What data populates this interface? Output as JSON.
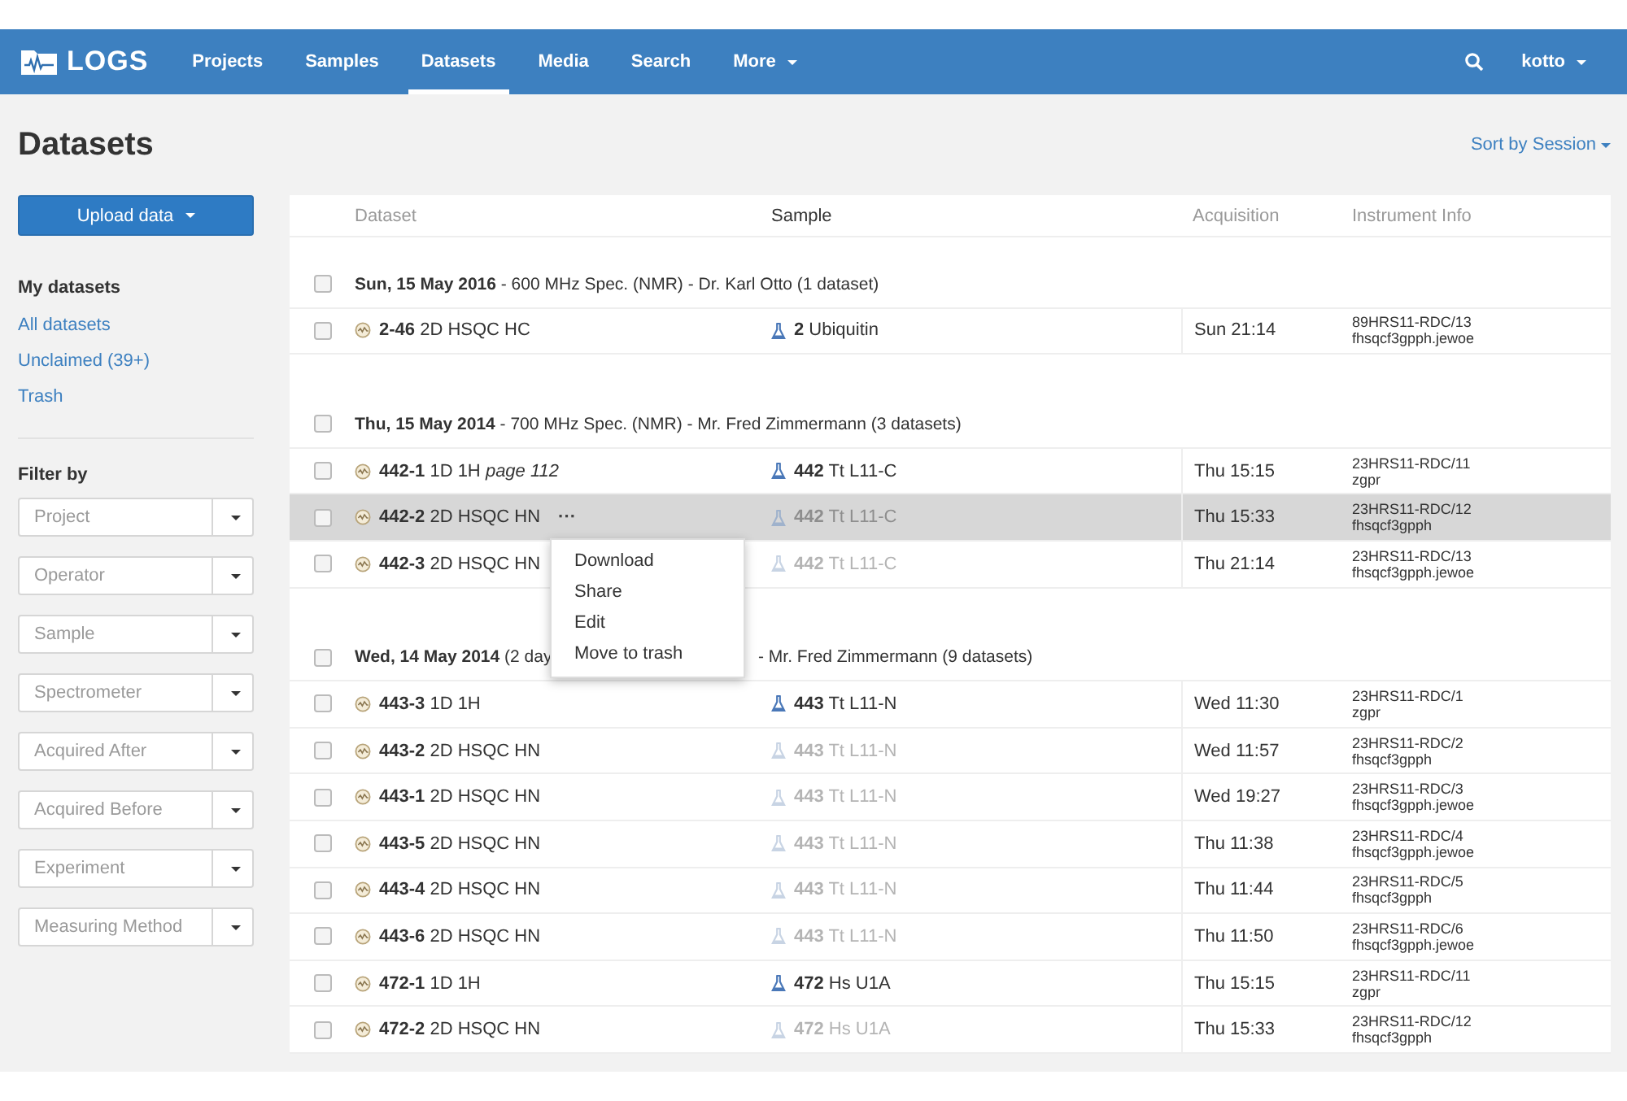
{
  "navbar": {
    "logo": "LOGS",
    "items": [
      {
        "label": "Projects",
        "selected": false
      },
      {
        "label": "Samples",
        "selected": false
      },
      {
        "label": "Datasets",
        "selected": true
      },
      {
        "label": "Media",
        "selected": false
      },
      {
        "label": "Search",
        "selected": false
      },
      {
        "label": "More",
        "selected": false,
        "dropdown": true
      }
    ],
    "user": "kotto"
  },
  "page_title": "Datasets",
  "sort": "Sort by Session",
  "sidebar": {
    "upload_button": "Upload data",
    "section_title": "My datasets",
    "links": [
      "All datasets",
      "Unclaimed (39+)",
      "Trash"
    ],
    "filter_title": "Filter by",
    "filters": [
      {
        "placeholder": "Project"
      },
      {
        "placeholder": "Operator"
      },
      {
        "placeholder": "Sample"
      },
      {
        "placeholder": "Spectrometer"
      },
      {
        "placeholder": "Acquired After"
      },
      {
        "placeholder": "Acquired Before"
      },
      {
        "placeholder": "Experiment"
      },
      {
        "placeholder": "Measuring Method"
      }
    ]
  },
  "table": {
    "columns": [
      "Dataset",
      "Sample",
      "Acquisition",
      "Instrument Info"
    ],
    "groups": [
      {
        "checked": false,
        "date": "Sun, 15 May 2016",
        "info": "- 600 MHz Spec. (NMR) - Dr. Karl Otto (1 dataset)",
        "rows": [
          {
            "checked": false,
            "selected": false,
            "id": "2-46",
            "name": "2D HSQC HC",
            "sample_no": "2",
            "sample": "Ubiquitin",
            "sample_active": true,
            "acquisition": "Sun 21:14",
            "instrument": [
              "89HRS11-RDC/13",
              "fhsqcf3gpph.jewoe"
            ]
          }
        ]
      },
      {
        "checked": false,
        "date": "Thu, 15 May 2014",
        "info": "- 700 MHz Spec. (NMR) - Mr. Fred Zimmermann (3 datasets)",
        "rows": [
          {
            "checked": false,
            "selected": false,
            "id": "442-1",
            "name": "1D 1H",
            "note": "page 112",
            "sample_no": "442",
            "sample": "Tt L11-C",
            "sample_active": true,
            "acquisition": "Thu 15:15",
            "instrument": [
              "23HRS11-RDC/11",
              "zgpr"
            ]
          },
          {
            "checked": false,
            "selected": true,
            "id": "442-2",
            "name": "2D HSQC HN",
            "more": "···",
            "sample_no": "442",
            "sample": "Tt L11-C",
            "sample_active": false,
            "acquisition": "Thu 15:33",
            "instrument": [
              "23HRS11-RDC/12",
              "fhsqcf3gpph"
            ],
            "menu": [
              "Download",
              "Share",
              "Edit",
              "Move to trash"
            ]
          },
          {
            "checked": false,
            "selected": false,
            "id": "442-3",
            "name": "2D HSQC HN",
            "sample_no": "442",
            "sample": "Tt L11-C",
            "sample_active": false,
            "acquisition": "Thu 21:14",
            "instrument": [
              "23HRS11-RDC/13",
              "fhsqcf3gpph.jewoe"
            ]
          }
        ]
      },
      {
        "checked": false,
        "date": "Wed, 14 May 2014",
        "info": "(2 day",
        "info_after_menu": "- Mr. Fred Zimmermann (9 datasets)",
        "rows": [
          {
            "checked": false,
            "selected": false,
            "id": "443-3",
            "name": "1D 1H",
            "sample_no": "443",
            "sample": "Tt L11-N",
            "sample_active": true,
            "acquisition": "Wed 11:30",
            "instrument": [
              "23HRS11-RDC/1",
              "zgpr"
            ]
          },
          {
            "checked": false,
            "selected": false,
            "id": "443-2",
            "name": "2D HSQC HN",
            "sample_no": "443",
            "sample": "Tt L11-N",
            "sample_active": false,
            "acquisition": "Wed 11:57",
            "instrument": [
              "23HRS11-RDC/2",
              "fhsqcf3gpph"
            ]
          },
          {
            "checked": false,
            "selected": false,
            "id": "443-1",
            "name": "2D HSQC HN",
            "sample_no": "443",
            "sample": "Tt L11-N",
            "sample_active": false,
            "acquisition": "Wed 19:27",
            "instrument": [
              "23HRS11-RDC/3",
              "fhsqcf3gpph.jewoe"
            ]
          },
          {
            "checked": false,
            "selected": false,
            "id": "443-5",
            "name": "2D HSQC HN",
            "sample_no": "443",
            "sample": "Tt L11-N",
            "sample_active": false,
            "acquisition": "Thu 11:38",
            "instrument": [
              "23HRS11-RDC/4",
              "fhsqcf3gpph.jewoe"
            ]
          },
          {
            "checked": false,
            "selected": false,
            "id": "443-4",
            "name": "2D HSQC HN",
            "sample_no": "443",
            "sample": "Tt L11-N",
            "sample_active": false,
            "acquisition": "Thu 11:44",
            "instrument": [
              "23HRS11-RDC/5",
              "fhsqcf3gpph"
            ]
          },
          {
            "checked": false,
            "selected": false,
            "id": "443-6",
            "name": "2D HSQC HN",
            "sample_no": "443",
            "sample": "Tt L11-N",
            "sample_active": false,
            "acquisition": "Thu 11:50",
            "instrument": [
              "23HRS11-RDC/6",
              "fhsqcf3gpph.jewoe"
            ]
          },
          {
            "checked": false,
            "selected": false,
            "id": "472-1",
            "name": "1D 1H",
            "sample_no": "472",
            "sample": "Hs U1A",
            "sample_active": true,
            "acquisition": "Thu 15:15",
            "instrument": [
              "23HRS11-RDC/11",
              "zgpr"
            ]
          },
          {
            "checked": false,
            "selected": false,
            "id": "472-2",
            "name": "2D HSQC HN",
            "sample_no": "472",
            "sample": "Hs U1A",
            "sample_active": false,
            "acquisition": "Thu 15:33",
            "instrument": [
              "23HRS11-RDC/12",
              "fhsqcf3gpph"
            ]
          }
        ]
      }
    ]
  }
}
